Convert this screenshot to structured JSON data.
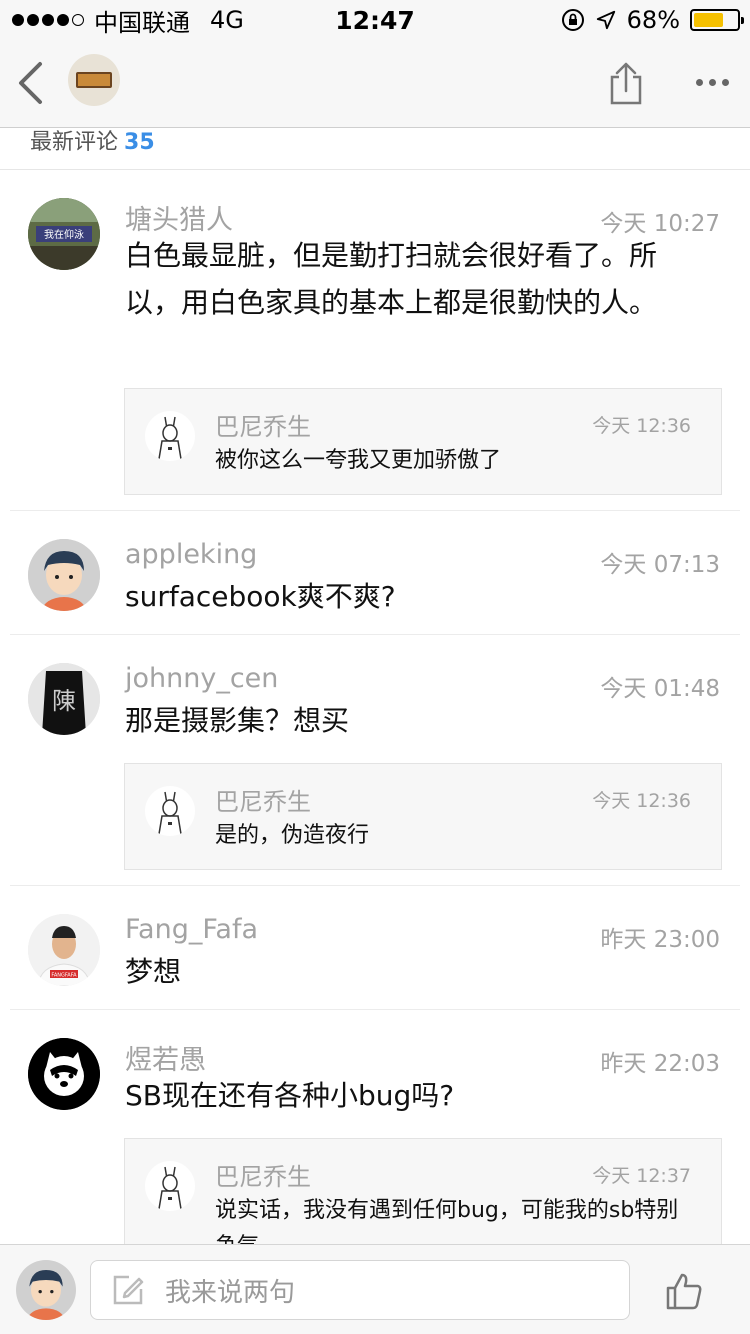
{
  "status_bar": {
    "carrier": "中国联通",
    "network": "4G",
    "time": "12:47",
    "battery": "68%",
    "battery_level": 0.68
  },
  "nav": {
    "back_icon": "chevron-left-icon",
    "share_icon": "share-icon",
    "more_icon": "more-icon"
  },
  "section": {
    "title": "最新评论",
    "count": "35"
  },
  "comments": [
    {
      "name": "塘头猎人",
      "time": "今天 10:27",
      "text": "白色最显脏，但是勤打扫就会很好看了。所以，用白色家具的基本上都是很勤快的人。",
      "reply": {
        "name": "巴尼乔生",
        "time": "今天 12:36",
        "text": "被你这么一夸我又更加骄傲了"
      }
    },
    {
      "name": "appleking",
      "time": "今天 07:13",
      "text": "surfacebook爽不爽?"
    },
    {
      "name": "johnny_cen",
      "time": "今天 01:48",
      "text": "那是摄影集？想买",
      "reply": {
        "name": "巴尼乔生",
        "time": "今天 12:36",
        "text": "是的，伪造夜行"
      }
    },
    {
      "name": "Fang_Fafa",
      "time": "昨天 23:00",
      "text": "梦想"
    },
    {
      "name": "煜若愚",
      "time": "昨天 22:03",
      "text": "SB现在还有各种小bug吗?",
      "reply": {
        "name": "巴尼乔生",
        "time": "今天 12:37",
        "text": "说实话，我没有遇到任何bug，可能我的sb特别争气"
      }
    }
  ],
  "bottom_bar": {
    "placeholder": "我来说两句",
    "compose_icon": "compose-icon",
    "like_icon": "thumbs-up-icon"
  },
  "avatar_texts": {
    "c0_sign": "我在仰泳",
    "c2_char": "陳",
    "c3_shirt": "FANGFAFA"
  },
  "colors": {
    "accent": "#3a8ee6",
    "battery": "#f5c000",
    "meta_gray": "#a3a3a3"
  }
}
